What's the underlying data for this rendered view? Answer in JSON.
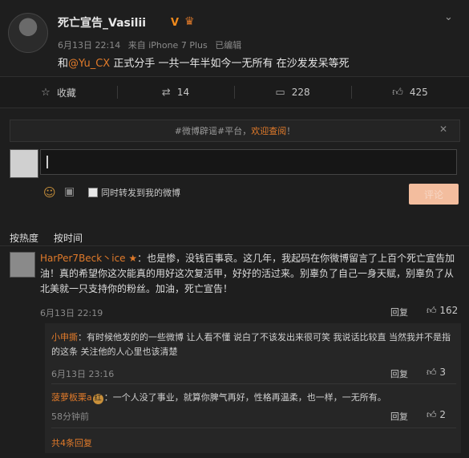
{
  "post": {
    "username": "死亡宣告_Vasilii",
    "verified_badge": "V",
    "time": "6月13日 22:14",
    "source": "来自 iPhone 7 Plus",
    "edited": "已编辑",
    "text_prefix": "和",
    "mention": "@Yu_CX",
    "text_suffix": " 正式分手 一共一年半如今一无所有 在沙发发呆等死"
  },
  "actions": {
    "favorite_label": "收藏",
    "repost_count": "14",
    "comment_count": "228",
    "like_count": "425"
  },
  "notice": {
    "prefix": "#微博辟谣#平台，",
    "link": "欢迎查阅",
    "suffix": "！"
  },
  "composer": {
    "repost_checkbox_label": "同时转发到我的微博",
    "send_label": "评论"
  },
  "sort": {
    "by_heat": "按热度",
    "by_time": "按时间"
  },
  "comment": {
    "name": "HarPer7Beck丶ice",
    "text": "：也是惨，没钱百事哀。这几年，我起码在你微博留言了上百个死亡宣告加油！真的希望你这次能真的用好这次复活甲，好好的活过来。别辜负了自己一身天赋，别辜负了从北美就一只支持你的粉丝。加油，死亡宣告！",
    "time": "6月13日 22:19",
    "reply_label": "回复",
    "likes": "162"
  },
  "replies": [
    {
      "name": "小申撕",
      "text": "：有时候他发的的一些微博 让人看不懂 说白了不该发出来很可笑 我说话比较直 当然我并不是指的这条  关注他的人心里也该清楚",
      "time": "6月13日 23:16",
      "reply_label": "回复",
      "likes": "3"
    },
    {
      "name": "菠萝板栗a",
      "badge": "红",
      "text": "：一个人没了事业，就算你脾气再好，性格再温柔，也一样，一无所有。",
      "time": "58分钟前",
      "reply_label": "回复",
      "likes": "2"
    }
  ],
  "more_replies": "共4条回复",
  "colors": {
    "background": "#1e1e1e",
    "accent": "#e07a2a",
    "send_button": "#f3bd9e"
  },
  "icons": [
    "chevron-down-icon",
    "star-icon",
    "repost-icon",
    "comment-icon",
    "thumb-up-icon",
    "emoji-icon",
    "picture-icon",
    "close-icon"
  ]
}
